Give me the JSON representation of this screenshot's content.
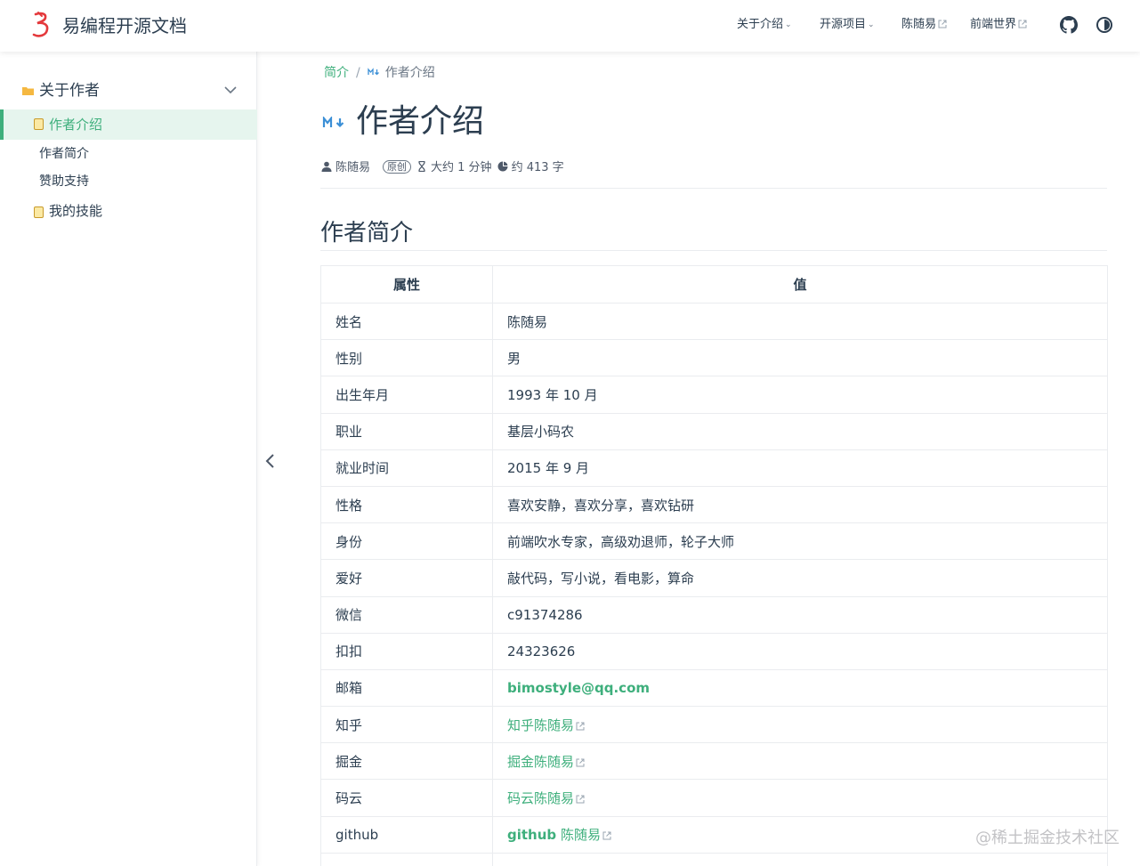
{
  "navbar": {
    "brand": "易编程开源文档",
    "items": [
      {
        "label": "关于介绍",
        "type": "dropdown"
      },
      {
        "label": "开源项目",
        "type": "dropdown"
      },
      {
        "label": "陈随易",
        "type": "external"
      },
      {
        "label": "前端世界",
        "type": "external"
      }
    ],
    "icons": [
      "github-icon",
      "theme-toggle-icon"
    ]
  },
  "sidebar": {
    "group_label": "关于作者",
    "items": [
      {
        "label": "作者介绍",
        "active": true,
        "icon": "document-icon"
      },
      {
        "label": "作者简介",
        "active": false
      },
      {
        "label": "赞助支持",
        "active": false
      },
      {
        "label": "我的技能",
        "active": false,
        "icon": "document-icon"
      }
    ]
  },
  "breadcrumb": {
    "root": "简介",
    "separator": "/",
    "current": "作者介绍"
  },
  "page": {
    "title": "作者介绍",
    "meta": {
      "author": "陈随易",
      "badge": "原创",
      "read_time": "大约 1 分钟",
      "word_count": "约 413 字"
    },
    "section_heading": "作者简介"
  },
  "table": {
    "headers": [
      "属性",
      "值"
    ],
    "rows": [
      {
        "key": "姓名",
        "value": "陈随易"
      },
      {
        "key": "性别",
        "value": "男"
      },
      {
        "key": "出生年月",
        "value": "1993 年 10 月"
      },
      {
        "key": "职业",
        "value": "基层小码农"
      },
      {
        "key": "就业时间",
        "value": "2015 年 9 月"
      },
      {
        "key": "性格",
        "value": "喜欢安静，喜欢分享，喜欢钻研"
      },
      {
        "key": "身份",
        "value": "前端吹水专家，高级劝退师，轮子大师"
      },
      {
        "key": "爱好",
        "value": "敲代码，写小说，看电影，算命"
      },
      {
        "key": "微信",
        "value": "c91374286"
      },
      {
        "key": "扣扣",
        "value": "24323626"
      },
      {
        "key": "邮箱",
        "value": "bimostyle@qq.com"
      },
      {
        "key": "知乎",
        "value": "知乎陈随易"
      },
      {
        "key": "掘金",
        "value": "掘金陈随易"
      },
      {
        "key": "码云",
        "value": "码云陈随易"
      },
      {
        "key": "github",
        "value_prefix": "github",
        "value": "陈随易"
      }
    ]
  },
  "watermark": "@稀土掘金技术社区",
  "colors": {
    "accent": "#3eaf7c",
    "text": "#2c3e50",
    "border": "#eaecef"
  }
}
